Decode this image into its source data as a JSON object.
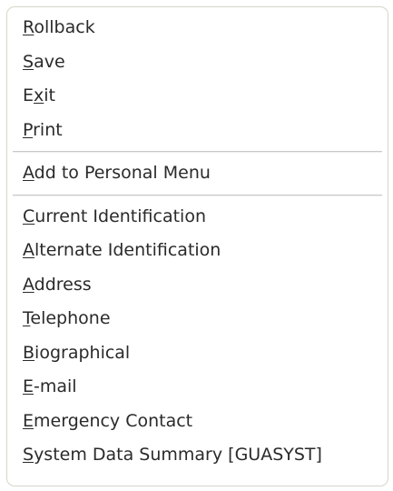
{
  "menu": {
    "groups": [
      {
        "items": [
          {
            "label": "Rollback",
            "mnemonic": "R"
          },
          {
            "label": "Save",
            "mnemonic": "S"
          },
          {
            "label": "Exit",
            "mnemonic": "x"
          },
          {
            "label": "Print",
            "mnemonic": "P"
          }
        ]
      },
      {
        "items": [
          {
            "label": "Add to Personal Menu",
            "mnemonic": "A"
          }
        ]
      },
      {
        "items": [
          {
            "label": "Current Identification",
            "mnemonic": "C"
          },
          {
            "label": "Alternate Identification",
            "mnemonic": "A"
          },
          {
            "label": "Address",
            "mnemonic": "A"
          },
          {
            "label": "Telephone",
            "mnemonic": "T"
          },
          {
            "label": "Biographical",
            "mnemonic": "B"
          },
          {
            "label": "E-mail",
            "mnemonic": "E"
          },
          {
            "label": "Emergency Contact",
            "mnemonic": "E"
          },
          {
            "label": "System Data Summary [GUASYST]",
            "mnemonic": "S"
          }
        ]
      }
    ],
    "colors": {
      "text": "#2a2a2a",
      "border": "#d4d6c8",
      "separator": "#c8c8c8",
      "background": "#ffffff"
    }
  }
}
